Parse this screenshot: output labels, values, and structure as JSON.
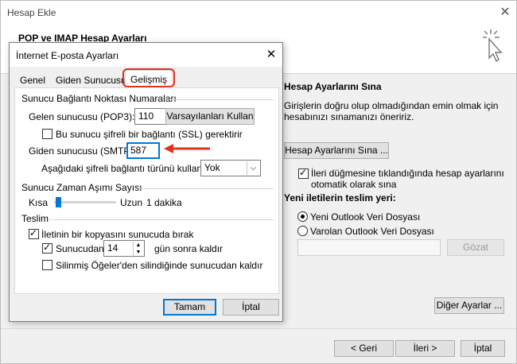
{
  "outer": {
    "title": "Hesap Ekle",
    "close": "✕",
    "heading": "POP ve IMAP Hesap Ayarları",
    "test_section_title": "Hesap Ayarlarını Sına",
    "test_desc_line1": "Girişlerin doğru olup olmadığından emin olmak için",
    "test_desc_line2": "hesabınızı sınamanızı öneririz.",
    "test_button": "Hesap Ayarlarını Sına ...",
    "auto_test_line1": "İleri düğmesine tıklandığında hesap ayarlarını",
    "auto_test_line2": "otomatik olarak sına",
    "auto_test_checked": true,
    "deliver_title": "Yeni iletilerin teslim yeri:",
    "radio_new": "Yeni Outlook Veri Dosyası",
    "radio_existing": "Varolan Outlook Veri Dosyası",
    "selected_radio": "new",
    "browse_button": "Gözat",
    "more_settings_button": "Diğer Ayarlar ...",
    "back_button": "< Geri",
    "next_button": "İleri >",
    "cancel_button": "İptal"
  },
  "dialog": {
    "title": "İnternet E-posta Ayarları",
    "close": "✕",
    "tabs": [
      {
        "label": "Genel"
      },
      {
        "label": "Giden Sunucusu"
      },
      {
        "label": "Gelişmiş",
        "active": true
      }
    ],
    "server_ports_title": "Sunucu Bağlantı Noktası Numaraları",
    "incoming_label": "Gelen sunucusu (POP3):",
    "incoming_value": "110",
    "defaults_button": "Varsayılanları Kullan",
    "ssl_label": "Bu sunucu şifreli bir bağlantı (SSL) gerektirir",
    "ssl_checked": false,
    "outgoing_label": "Giden sunucusu (SMTP):",
    "outgoing_value": "587",
    "encryption_label": "Aşağıdaki şifreli bağlantı türünü kullan:",
    "encryption_value": "Yok",
    "timeout_title": "Sunucu Zaman Aşımı Sayısı",
    "timeout_short": "Kısa",
    "timeout_long": "Uzun",
    "timeout_value": "1 dakika",
    "timeout_slider_fraction": 0.03,
    "delivery_title": "Teslim",
    "leave_copy_label": "İletinin bir kopyasını sunucuda bırak",
    "leave_copy_checked": true,
    "remove_after_label": "Sunucudan",
    "remove_after_checked": true,
    "remove_after_days": "14",
    "remove_after_suffix": "gün sonra kaldır",
    "remove_deleted_label": "Silinmiş Öğeler'den silindiğinde sunucudan kaldır",
    "remove_deleted_checked": false,
    "ok_button": "Tamam",
    "cancel_button": "İptal"
  },
  "colors": {
    "highlight_red": "#e0301e",
    "focus_blue": "#0078d7"
  }
}
